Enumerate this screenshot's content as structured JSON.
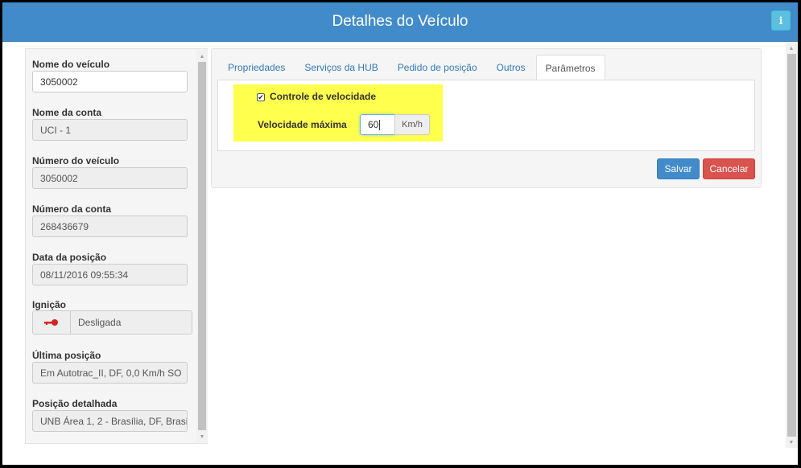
{
  "header": {
    "title": "Detalhes do Veículo",
    "info_label": "i"
  },
  "left": {
    "fields": [
      {
        "label": "Nome do veículo",
        "value": "3050002"
      },
      {
        "label": "Nome da conta",
        "value": "UCI - 1"
      },
      {
        "label": "Número do veículo",
        "value": "3050002"
      },
      {
        "label": "Número da conta",
        "value": "268436679"
      },
      {
        "label": "Data da posição",
        "value": "08/11/2016 09:55:34"
      },
      {
        "label": "Ignição",
        "value": "Desligada"
      },
      {
        "label": "Última posição",
        "value": "Em  Autotrac_II, DF, 0,0 Km/h SO"
      },
      {
        "label": "Posição detalhada",
        "value": "UNB Área 1, 2 - Brasília, DF, Brasi"
      }
    ]
  },
  "tabs": [
    {
      "label": "Propriedades"
    },
    {
      "label": "Serviços da HUB"
    },
    {
      "label": "Pedido de posição"
    },
    {
      "label": "Outros"
    },
    {
      "label": "Parâmetros"
    }
  ],
  "params": {
    "checkbox_label": "Controle de velocidade",
    "checked_mark": "✔",
    "speed_label": "Velocidade máxima",
    "speed_value": "60",
    "speed_unit": "Km/h"
  },
  "buttons": {
    "save": "Salvar",
    "cancel": "Cancelar"
  },
  "colors": {
    "header": "#428bca",
    "primary": "#428bca",
    "danger": "#d9534f",
    "highlight": "#ffff4d",
    "key_icon": "#d9231e"
  }
}
